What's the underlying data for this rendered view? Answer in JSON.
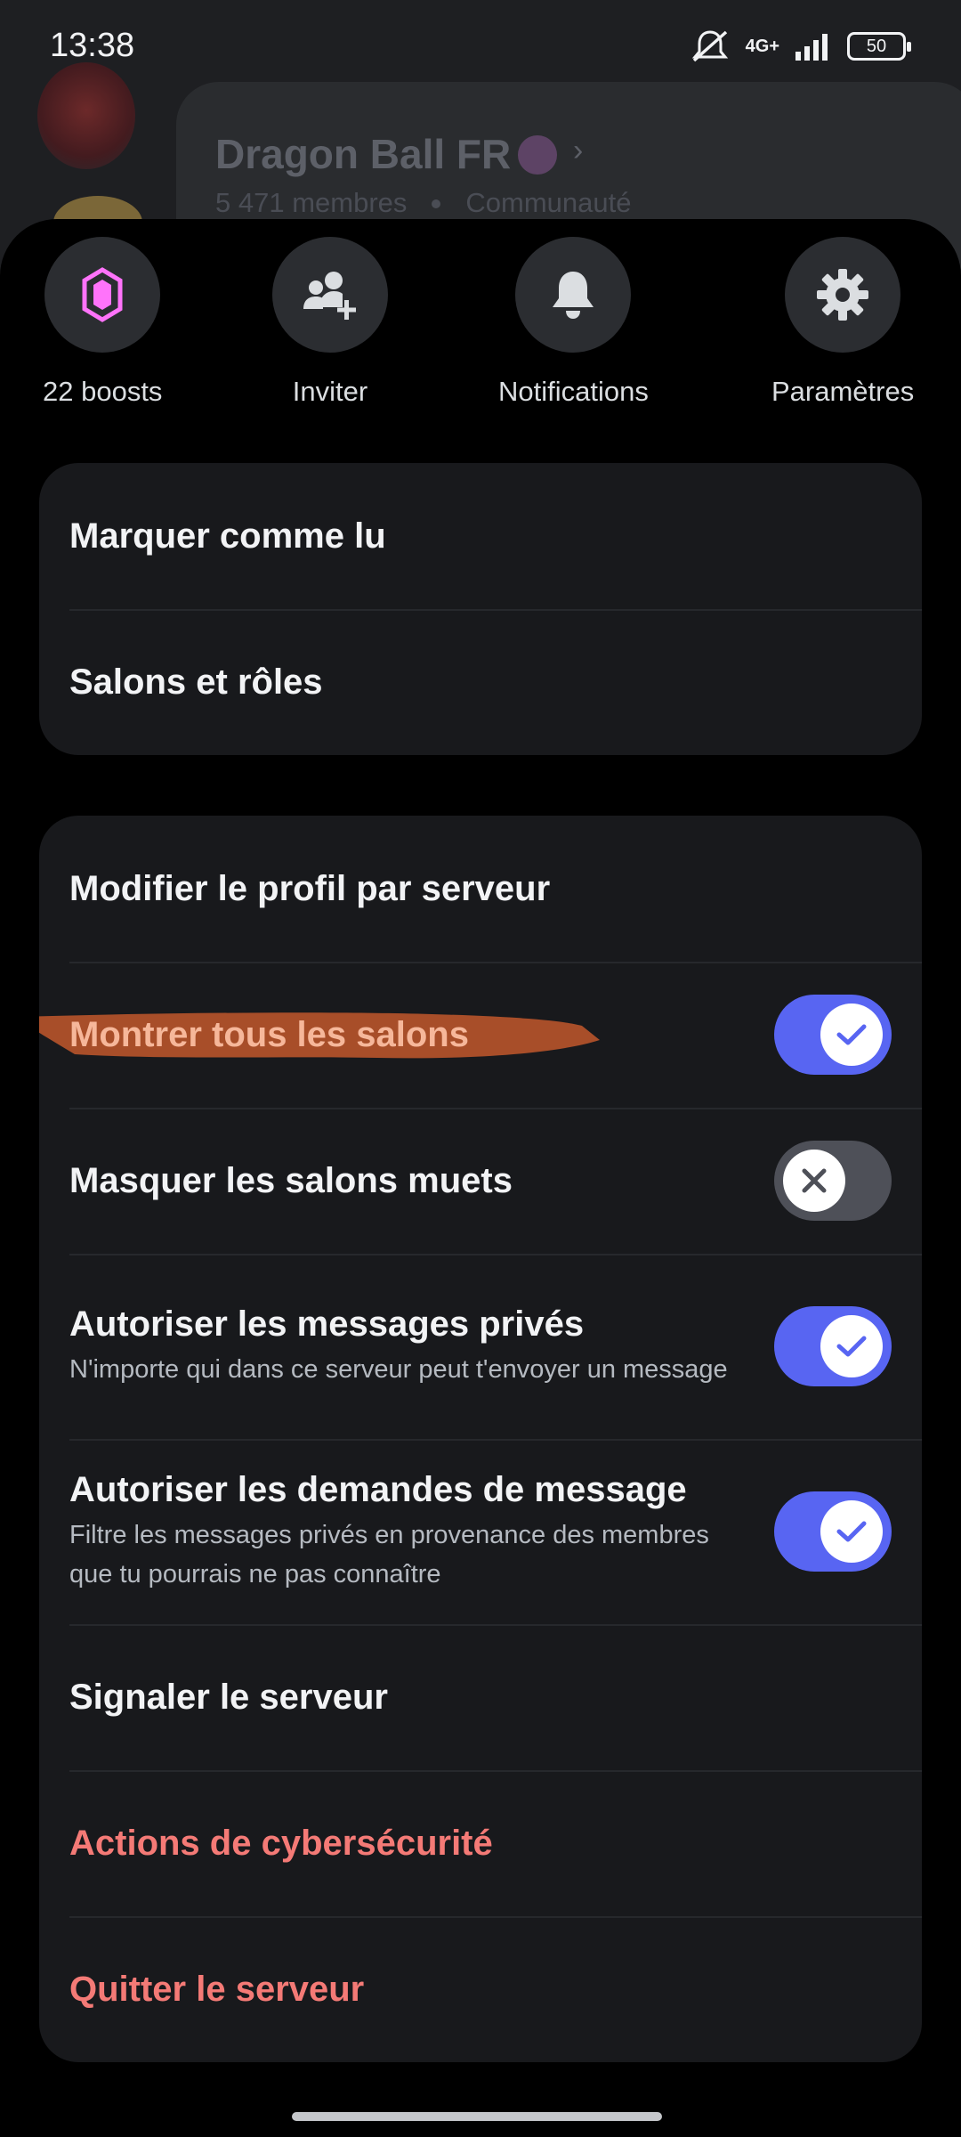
{
  "status_bar": {
    "time": "13:38",
    "network": "4G+",
    "battery": "50",
    "icons": [
      "mute-icon",
      "signal-icon",
      "battery-icon"
    ]
  },
  "background": {
    "server_name": "Dragon Ball FR",
    "members": "5 471 membres",
    "community": "Communauté"
  },
  "quick_actions": [
    {
      "label": "22 boosts",
      "icon": "boost-gem-icon",
      "accent": "#ff73fa"
    },
    {
      "label": "Inviter",
      "icon": "invite-user-icon"
    },
    {
      "label": "Notifications",
      "icon": "bell-icon"
    },
    {
      "label": "Paramètres",
      "icon": "gear-icon"
    }
  ],
  "menu_group_1": [
    {
      "label": "Marquer comme lu"
    },
    {
      "label": "Salons et rôles"
    }
  ],
  "menu_group_2": {
    "edit_profile": "Modifier le profil par serveur",
    "show_all_channels": {
      "label": "Montrer tous les salons",
      "enabled": true
    },
    "hide_muted": {
      "label": "Masquer les salons muets",
      "enabled": false
    },
    "allow_dms": {
      "label": "Autoriser les messages privés",
      "sub": "N'importe qui dans ce serveur peut t'envoyer un message",
      "enabled": true
    },
    "allow_requests": {
      "label": "Autoriser les demandes de message",
      "sub": "Filtre les messages privés en provenance des membres que tu pourrais ne pas connaître",
      "enabled": true
    },
    "report": "Signaler le serveur",
    "security_actions": "Actions de cybersécurité",
    "leave": "Quitter le serveur"
  },
  "colors": {
    "accent": "#5865f2",
    "danger": "#f47a76",
    "annotation": "#b5532a"
  }
}
